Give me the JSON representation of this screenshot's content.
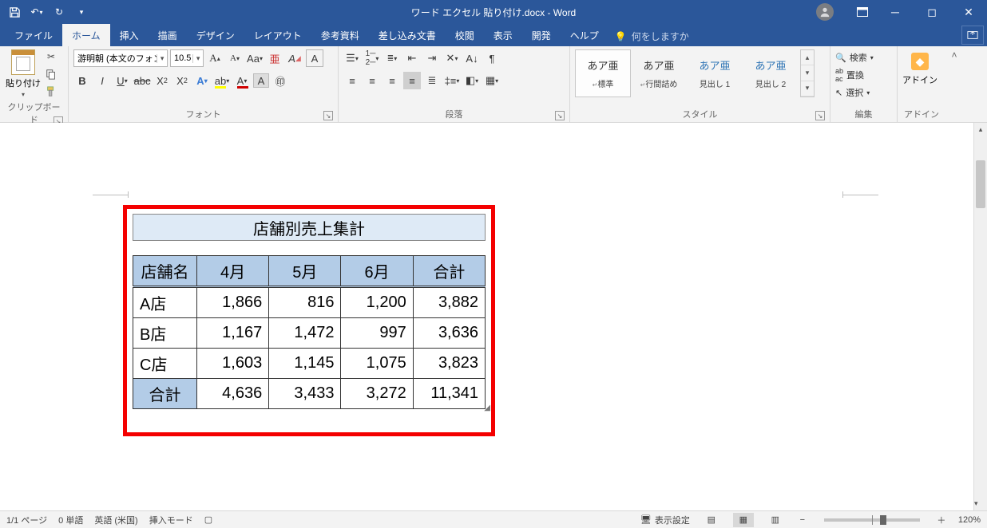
{
  "titlebar": {
    "doc_title": "ワード エクセル 貼り付け.docx - Word"
  },
  "tabs": {
    "file": "ファイル",
    "home": "ホーム",
    "insert": "挿入",
    "draw": "描画",
    "design": "デザイン",
    "layout": "レイアウト",
    "references": "参考資料",
    "mailings": "差し込み文書",
    "review": "校閲",
    "view": "表示",
    "developer": "開発",
    "help": "ヘルプ",
    "tell_me": "何をしますか"
  },
  "ribbon": {
    "clipboard": {
      "label": "クリップボード",
      "paste": "貼り付け"
    },
    "font": {
      "label": "フォント",
      "name": "游明朝 (本文のフォン",
      "size": "10.5"
    },
    "paragraph": {
      "label": "段落"
    },
    "styles": {
      "label": "スタイル",
      "items": [
        {
          "preview": "あア亜",
          "name": "標準",
          "sym": "↵"
        },
        {
          "preview": "あア亜",
          "name": "行間詰め",
          "sym": "↵"
        },
        {
          "preview": "あア亜",
          "name": "見出し 1",
          "sym": ""
        },
        {
          "preview": "あア亜",
          "name": "見出し 2",
          "sym": ""
        }
      ]
    },
    "editing": {
      "label": "編集",
      "find": "検索",
      "replace": "置換",
      "select": "選択"
    },
    "addins": {
      "label": "アドイン",
      "btn": "アドイン"
    }
  },
  "document": {
    "table_title": "店舗別売上集計",
    "headers": [
      "店舗名",
      "4月",
      "5月",
      "6月",
      "合計"
    ],
    "rows": [
      {
        "label": "A店",
        "c1": "1,866",
        "c2": "816",
        "c3": "1,200",
        "c4": "3,882"
      },
      {
        "label": "B店",
        "c1": "1,167",
        "c2": "1,472",
        "c3": "997",
        "c4": "3,636"
      },
      {
        "label": "C店",
        "c1": "1,603",
        "c2": "1,145",
        "c3": "1,075",
        "c4": "3,823"
      }
    ],
    "total": {
      "label": "合計",
      "c1": "4,636",
      "c2": "3,433",
      "c3": "3,272",
      "c4": "11,341"
    }
  },
  "status": {
    "page": "1/1 ページ",
    "words": "0 単語",
    "lang": "英語 (米国)",
    "mode": "挿入モード",
    "display_settings": "表示設定",
    "zoom": "120%"
  }
}
